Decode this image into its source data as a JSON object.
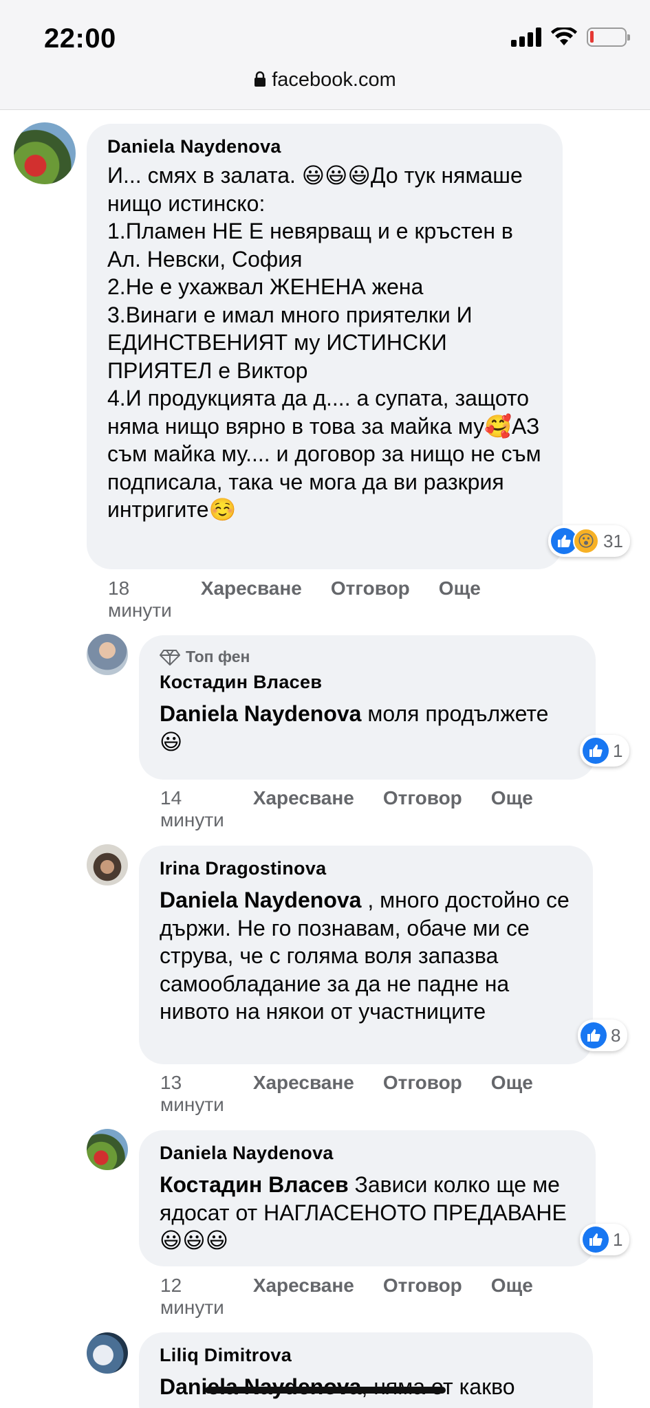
{
  "status_bar": {
    "time": "22:00"
  },
  "address_bar": {
    "url": "facebook.com"
  },
  "comments": [
    {
      "author": "Daniela Naydenova",
      "text_parts": [
        "И... смях в залата. 😃😃😃До тук нямаше нищо истинско:\n1.Пламен НЕ Е невярващ и е кръстен в Ал. Невски, София\n2.Не е ухажвал ЖЕНЕНА жена\n3.Винаги е имал много приятелки И ЕДИНСТВЕНИЯТ му ИСТИНСКИ ПРИЯТЕЛ е Виктор\n4.И продукцията да д.... а супата, защото няма нищо вярно в това за майка му🥰АЗ съм майка му.... и договор за нищо не съм подписала, така че мога да ви разкрия интригите☺️"
      ],
      "reaction_count": "31",
      "timestamp": "18 минути",
      "like_label": "Харесване",
      "reply_label": "Отговор",
      "more_label": "Още"
    },
    {
      "badge": "Топ фен",
      "author": "Костадин Власев",
      "mention": "Daniela Naydenova",
      "text": " моля продължете 😃",
      "reaction_count": "1",
      "timestamp": "14 минути",
      "like_label": "Харесване",
      "reply_label": "Отговор",
      "more_label": "Още"
    },
    {
      "author": "Irina Dragostinova",
      "mention": "Daniela Naydenova",
      "text": " , много достойно се държи. Не го познавам, обаче ми се струва, че с голяма воля запазва самообладание за да не падне на нивото на някои от участниците",
      "reaction_count": "8",
      "timestamp": "13 минути",
      "like_label": "Харесване",
      "reply_label": "Отговор",
      "more_label": "Още"
    },
    {
      "author": "Daniela Naydenova",
      "mention": "Костадин Власев",
      "text": " Зависи колко ще ме ядосат от НАГЛАСЕНОТО ПРЕДАВАНЕ😃😃😃",
      "reaction_count": "1",
      "timestamp": "12 минути",
      "like_label": "Харесване",
      "reply_label": "Отговор",
      "more_label": "Още"
    },
    {
      "author": "Liliq Dimitrova",
      "mention": "Daniela Naydenova",
      "text": ", няма от какво"
    }
  ]
}
